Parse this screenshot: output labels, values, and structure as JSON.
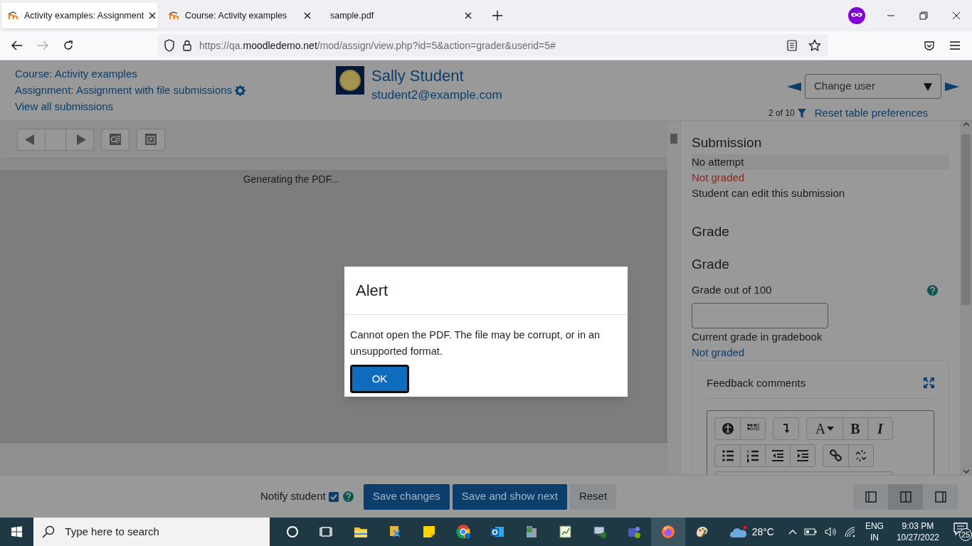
{
  "browser": {
    "tabs": [
      {
        "title": "Activity examples: Assignment",
        "selected": true,
        "kind": "moodle"
      },
      {
        "title": "Course: Activity examples",
        "selected": false,
        "kind": "moodle"
      },
      {
        "title": "sample.pdf",
        "selected": false,
        "kind": "pdf"
      }
    ],
    "url": {
      "prefix": "https://qa.",
      "domain": "moodledemo.net",
      "path": "/mod/assign/view.php?id=5&action=grader&userid=5#"
    }
  },
  "header": {
    "links": [
      "Course: Activity examples",
      "Assignment: Assignment with file submissions",
      "View all submissions"
    ],
    "user": {
      "name": "Sally Student",
      "email": "student2@example.com"
    },
    "change_user": {
      "placeholder": "Change user"
    },
    "count": "2 of 10",
    "reset_link": "Reset table preferences"
  },
  "pdf": {
    "status": "Generating the PDF..."
  },
  "panel": {
    "heading": "Submission",
    "status": [
      {
        "text": "No attempt",
        "kind": "plain"
      },
      {
        "text": "Not graded",
        "kind": "warning"
      },
      {
        "text": "Student can edit this submission",
        "kind": "plain"
      }
    ],
    "grade_headings": [
      "Grade",
      "Grade"
    ],
    "grade_label": "Grade out of 100",
    "current_label": "Current grade in gradebook",
    "current_value": "Not graded",
    "feedback": {
      "title": "Feedback comments",
      "toolbar": [
        [
          {
            "kind": "accessibility"
          },
          {
            "kind": "braille"
          }
        ],
        [
          {
            "kind": "down-arrow"
          }
        ],
        [
          {
            "kind": "font",
            "label": "A"
          },
          {
            "kind": "bold",
            "label": "B"
          },
          {
            "kind": "italic",
            "label": "I"
          }
        ]
      ]
    }
  },
  "bottom": {
    "notify": {
      "label": "Notify student",
      "checked": true
    },
    "buttons": [
      {
        "label": "Save changes",
        "kind": "primary"
      },
      {
        "label": "Save and show next",
        "kind": "primary"
      },
      {
        "label": "Reset",
        "kind": "secondary"
      }
    ],
    "layouts": [
      {
        "kind": "left",
        "selected": false
      },
      {
        "kind": "middle",
        "selected": true
      },
      {
        "kind": "right",
        "selected": false
      }
    ]
  },
  "dialog": {
    "title": "Alert",
    "message": "Cannot open the PDF. The file may be corrupt, or in an unsupported format.",
    "button": "OK"
  },
  "taskbar": {
    "search_placeholder": "Type here to search",
    "temperature": "28°C",
    "language": [
      "ENG",
      "IN"
    ],
    "time": "9:03 PM",
    "date": "10/27/2022",
    "notifications": "25"
  }
}
